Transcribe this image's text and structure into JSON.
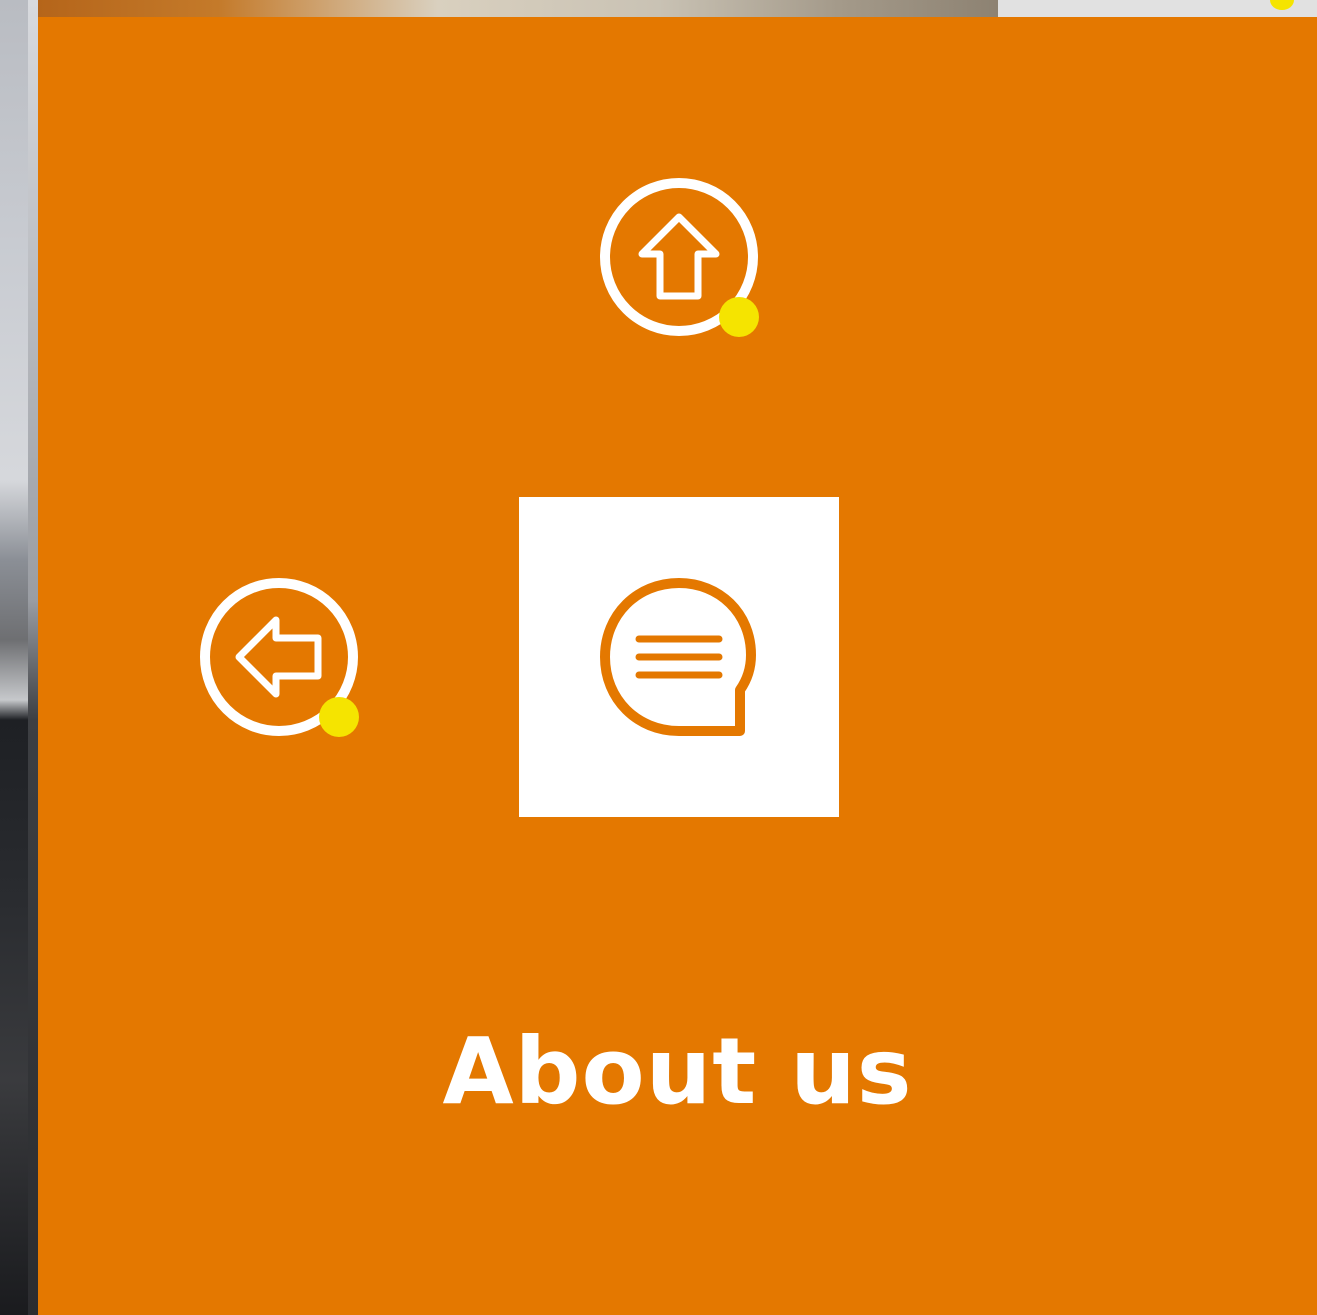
{
  "page": {
    "title": "About us",
    "accent_color": "#e47800",
    "indicator_color": "#f5e400"
  },
  "navigation": {
    "up": {
      "icon": "arrow-up-icon"
    },
    "left": {
      "icon": "arrow-left-icon"
    }
  },
  "tile": {
    "icon": "chat-bubble-icon"
  }
}
